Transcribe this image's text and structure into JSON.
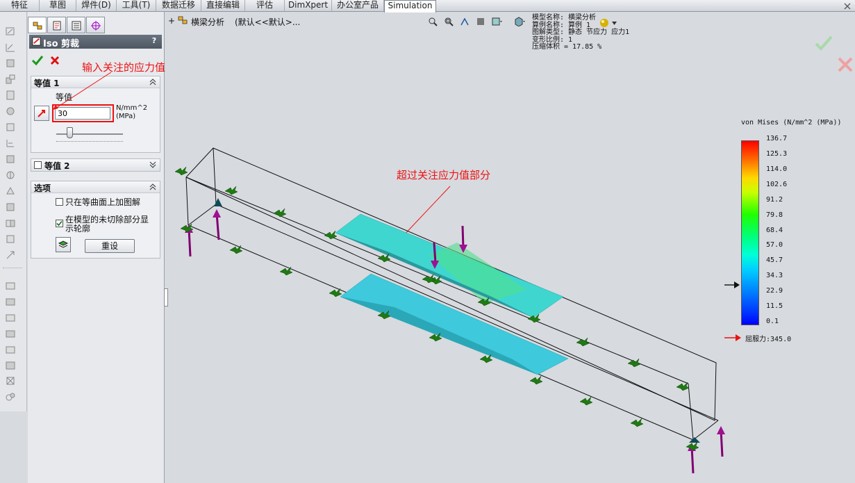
{
  "menubar": {
    "tabs": [
      "特征",
      "草图",
      "焊件(D)",
      "工具(T)",
      "数据迁移",
      "直接编辑",
      "评估",
      "DimXpert",
      "办公室产品",
      "Simulation"
    ],
    "active": "Simulation"
  },
  "panel": {
    "title": "Iso 剪裁",
    "help": "?",
    "group1": {
      "title": "等值 1",
      "value_label": "等值",
      "value": "30",
      "unit_line1": "N/mm^2",
      "unit_line2": "(MPa)",
      "slider_fraction": 0.2
    },
    "group2": {
      "title": "等值 2"
    },
    "options": {
      "title": "选项",
      "opt1": "只在等曲面上加图解",
      "opt1_checked": false,
      "opt2_line1": "在模型的未切除部分显",
      "opt2_line2": "示轮廓",
      "opt2_checked": true,
      "reset": "重设"
    },
    "annotation": "输入关注的应力值"
  },
  "viewport": {
    "tree_item": "横梁分析",
    "config": "(默认<<默认>...",
    "annotation": "超过关注应力值部分",
    "info": {
      "model": "模型名称: 横梁分析",
      "study": "算例名称: 算例 1",
      "plot_type": "图解类型: 静态 节应力 应力1",
      "deform": "变形比例: 1",
      "compress": "压缩体积 = 17.85 %"
    },
    "legend": {
      "title": "von Mises (N/mm^2 (MPa))",
      "ticks": [
        "136.7",
        "125.3",
        "114.0",
        "102.6",
        "91.2",
        "79.8",
        "68.4",
        "57.0",
        "45.7",
        "34.3",
        "22.9",
        "11.5",
        "0.1"
      ],
      "marker_value": 30,
      "yield": "屈服力:345.0"
    }
  }
}
